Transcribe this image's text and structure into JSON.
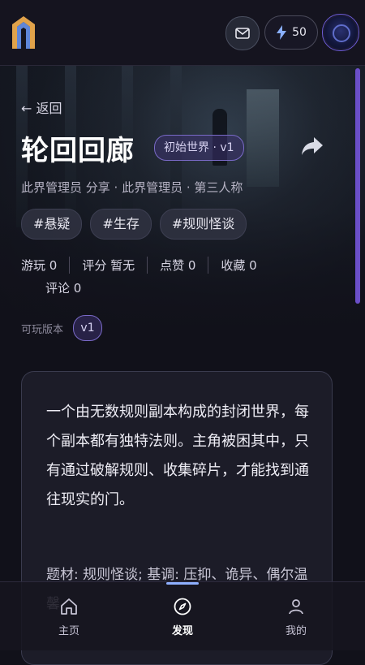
{
  "header": {
    "energy_count": "50",
    "icons": [
      "app-logo-icon",
      "mail-icon",
      "lightning-icon",
      "avatar"
    ]
  },
  "world": {
    "back_label": "← 返回",
    "title": "轮回回廊",
    "version_tag": "初始世界 · v1",
    "byline": "此界管理员 分享 · 此界管理员 · 第三人称",
    "tags": [
      "#悬疑",
      "#生存",
      "#规则怪谈"
    ],
    "stats": [
      "游玩 0",
      "评分 暂无",
      "点赞 0",
      "收藏 0",
      "评论 0"
    ],
    "playable_label": "可玩版本",
    "version_badge": "v1",
    "description": "一个由无数规则副本构成的封闭世界，每个副本都有独特法则。主角被困其中，只有通过破解规则、收集碎片，才能找到通往现实的门。",
    "meta": "题材: 规则怪谈; 基调: 压抑、诡异、偶尔温馨"
  },
  "nav": {
    "items": [
      {
        "label": "主页",
        "icon": "home-icon"
      },
      {
        "label": "发现",
        "icon": "compass-icon"
      },
      {
        "label": "我的",
        "icon": "user-icon"
      }
    ],
    "active_index": 1
  },
  "colors": {
    "accent": "#7a6ac8",
    "scrollbar": "#6b4fc8",
    "background": "#11111a"
  }
}
